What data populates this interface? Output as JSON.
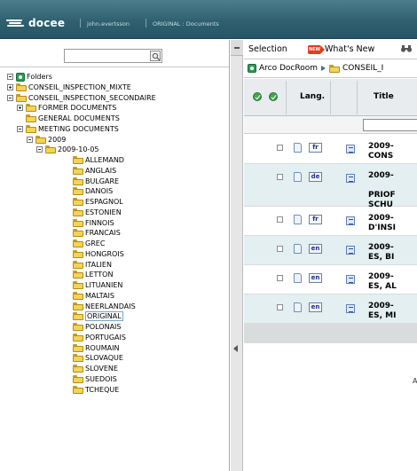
{
  "header": {
    "logo_text": "docee",
    "user": "john.evertsson",
    "path": "ORIGINAL : Documents"
  },
  "tree": {
    "search_placeholder": "",
    "root_label": "Folders",
    "items": [
      {
        "label": "CONSEIL_INSPECTION_MIXTE",
        "depth": 1,
        "toggle": "plus"
      },
      {
        "label": "CONSEIL_INSPECTION_SECONDAIRE",
        "depth": 1,
        "toggle": "minus"
      },
      {
        "label": "FORMER DOCUMENTS",
        "depth": 2,
        "toggle": "plus"
      },
      {
        "label": "GENERAL DOCUMENTS",
        "depth": 2,
        "toggle": "none"
      },
      {
        "label": "MEETING DOCUMENTS",
        "depth": 2,
        "toggle": "minus"
      },
      {
        "label": "2009",
        "depth": 3,
        "toggle": "minus"
      },
      {
        "label": "2009-10-05",
        "depth": 4,
        "toggle": "minus"
      },
      {
        "label": "ALLEMAND",
        "depth": 5,
        "toggle": "none"
      },
      {
        "label": "ANGLAIS",
        "depth": 5,
        "toggle": "none"
      },
      {
        "label": "BULGARE",
        "depth": 5,
        "toggle": "none"
      },
      {
        "label": "DANOIS",
        "depth": 5,
        "toggle": "none"
      },
      {
        "label": "ESPAGNOL",
        "depth": 5,
        "toggle": "none"
      },
      {
        "label": "ESTONIEN",
        "depth": 5,
        "toggle": "none"
      },
      {
        "label": "FINNOIS",
        "depth": 5,
        "toggle": "none"
      },
      {
        "label": "FRANCAIS",
        "depth": 5,
        "toggle": "none"
      },
      {
        "label": "GREC",
        "depth": 5,
        "toggle": "none"
      },
      {
        "label": "HONGROIS",
        "depth": 5,
        "toggle": "none"
      },
      {
        "label": "ITALIEN",
        "depth": 5,
        "toggle": "none"
      },
      {
        "label": "LETTON",
        "depth": 5,
        "toggle": "none"
      },
      {
        "label": "LITUANIEN",
        "depth": 5,
        "toggle": "none"
      },
      {
        "label": "MALTAIS",
        "depth": 5,
        "toggle": "none"
      },
      {
        "label": "NEERLANDAIS",
        "depth": 5,
        "toggle": "none"
      },
      {
        "label": "ORIGINAL",
        "depth": 5,
        "toggle": "none",
        "selected": true
      },
      {
        "label": "POLONAIS",
        "depth": 5,
        "toggle": "none"
      },
      {
        "label": "PORTUGAIS",
        "depth": 5,
        "toggle": "none"
      },
      {
        "label": "ROUMAIN",
        "depth": 5,
        "toggle": "none"
      },
      {
        "label": "SLOVAQUE",
        "depth": 5,
        "toggle": "none"
      },
      {
        "label": "SLOVENE",
        "depth": 5,
        "toggle": "none"
      },
      {
        "label": "SUEDOIS",
        "depth": 5,
        "toggle": "none"
      },
      {
        "label": "TCHEQUE",
        "depth": 5,
        "toggle": "none"
      }
    ]
  },
  "toolbar": {
    "selection": "Selection",
    "new_badge": "NEW",
    "whats_new": "What's New"
  },
  "breadcrumb": {
    "root": "Arco DocRoom",
    "current": "CONSEIL_I"
  },
  "grid": {
    "columns": {
      "lang": "Lang.",
      "title": "Title"
    },
    "rows": [
      {
        "lang": "fr",
        "title": [
          "2009-",
          "CONS"
        ],
        "alt": false
      },
      {
        "lang": "de",
        "title": [
          "2009-",
          "",
          "PRIOF",
          "SCHU"
        ],
        "alt": true
      },
      {
        "lang": "fr",
        "title": [
          "2009-",
          "D'INSI"
        ],
        "alt": false
      },
      {
        "lang": "en",
        "title": [
          "2009-",
          "ES, BI"
        ],
        "alt": true
      },
      {
        "lang": "en",
        "title": [
          "2009-",
          "ES, AL"
        ],
        "alt": false
      },
      {
        "lang": "en",
        "title": [
          "2009-",
          "ES, MI"
        ],
        "alt": true
      }
    ],
    "footer_text": "A"
  },
  "colors": {
    "header_bg": "#2f6170",
    "row_alt": "#e3eff0",
    "folder": "#f3d35a",
    "ok_green": "#46a34f",
    "new_badge": "#e33b1d"
  }
}
